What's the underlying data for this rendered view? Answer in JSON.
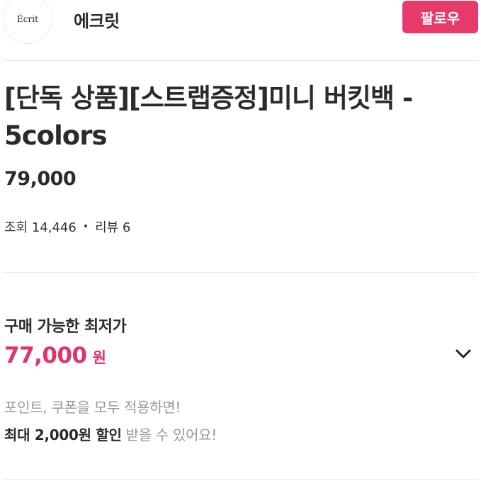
{
  "header": {
    "logo_text": "Écrit",
    "brand_name": "에크릿",
    "follow_label": "팔로우"
  },
  "product": {
    "title": "[단독 상품][스트랩증정]미니 버킷백 - 5colors",
    "price": "79,000",
    "views_label": "조회 14,446",
    "separator": "•",
    "reviews_label": "리뷰 6"
  },
  "lowest_price": {
    "label": "구매 가능한 최저가",
    "amount": "77,000",
    "unit": "원",
    "note": "포인트, 쿠폰을 모두 적용하면!",
    "discount_strong": "최대 2,000원 할인",
    "discount_rest": "받을 수 있어요!"
  },
  "colors": {
    "accent": "#e8396b",
    "price_pink": "#e0336a",
    "muted_text": "#999999"
  },
  "icons": {
    "expand": "chevron-down-icon"
  }
}
